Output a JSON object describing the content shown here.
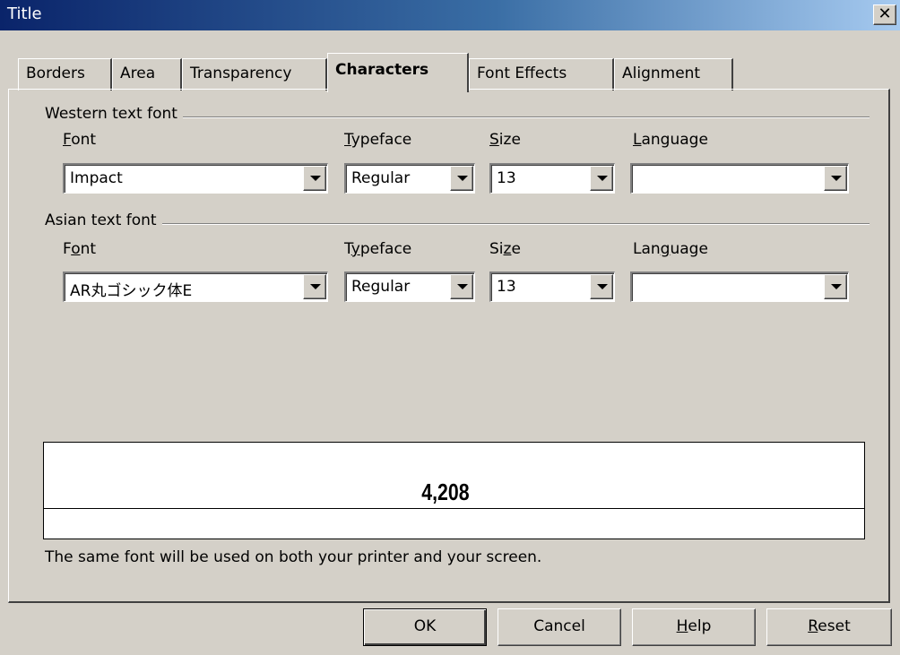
{
  "window": {
    "title": "Title",
    "close_glyph": "✕"
  },
  "tabs": [
    {
      "label": "Borders",
      "active": false
    },
    {
      "label": "Area",
      "active": false
    },
    {
      "label": "Transparency",
      "active": false
    },
    {
      "label": "Characters",
      "active": true
    },
    {
      "label": "Font Effects",
      "active": false
    },
    {
      "label": "Alignment",
      "active": false
    }
  ],
  "western": {
    "heading": "Western text font",
    "font": {
      "label_key": "F",
      "label_rest": "ont",
      "value": "Impact"
    },
    "typeface": {
      "label_key": "T",
      "label_rest": "ypeface",
      "value": "Regular"
    },
    "size": {
      "label_key": "S",
      "label_rest": "ize",
      "value": "13"
    },
    "language": {
      "label_key": "L",
      "label_rest": "anguage",
      "value": ""
    }
  },
  "asian": {
    "heading": "Asian text font",
    "font": {
      "label_pre": "F",
      "label_key": "o",
      "label_rest": "nt",
      "value": "AR丸ゴシック体E"
    },
    "typeface": {
      "label_pre": "T",
      "label_key": "y",
      "label_rest": "peface",
      "value": "Regular"
    },
    "size": {
      "label_pre": "Si",
      "label_key": "z",
      "label_rest": "e",
      "value": "13"
    },
    "language": {
      "label_pre": "Lan",
      "label_key": "g",
      "label_rest": "uage",
      "value": ""
    }
  },
  "preview": {
    "sample_text": "4,208",
    "note": "The same font will be used on both your printer and your screen."
  },
  "buttons": {
    "ok": "OK",
    "cancel": "Cancel",
    "help_key": "H",
    "help_rest": "elp",
    "reset_key": "R",
    "reset_rest": "eset"
  }
}
